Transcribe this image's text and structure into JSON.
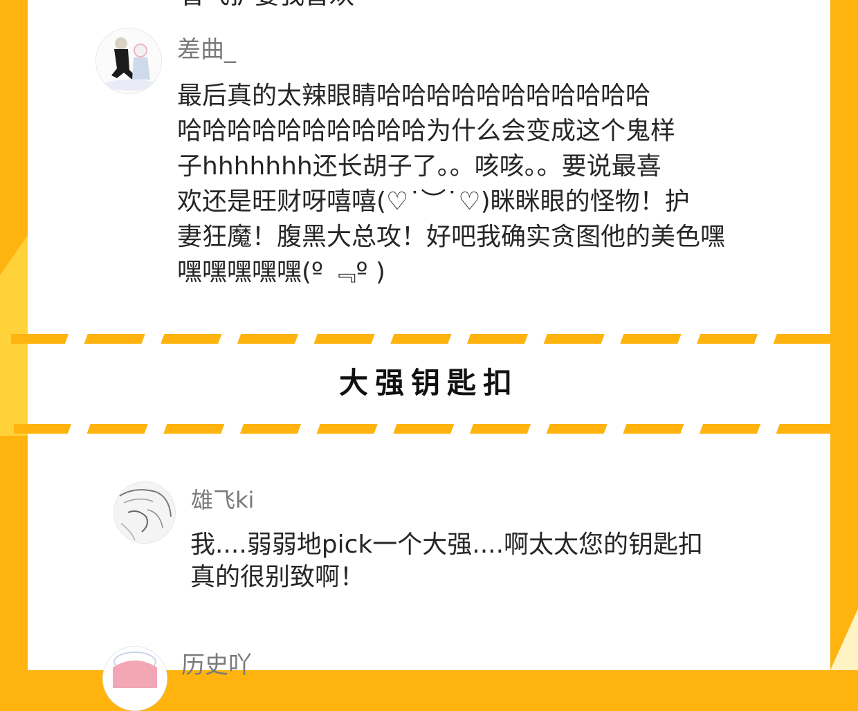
{
  "clipped_top_text": "曾飞护妻我喜欢",
  "comments": [
    {
      "username": "差曲_",
      "lines": [
        "最后真的太辣眼睛哈哈哈哈哈哈哈哈哈哈哈",
        "哈哈哈哈哈哈哈哈哈哈为什么会变成这个鬼样",
        "子hhhhhhh还长胡子了。。咳咳。。要说最喜",
        "欢还是旺财呀嘻嘻(♡˙︶˙♡)眯眯眼的怪物！护",
        "妻狂魔！腹黑大总攻！好吧我确实贪图他的美色嘿",
        "嘿嘿嘿嘿嘿(º ﹃º )"
      ]
    },
    {
      "username": "雄飞ki",
      "lines": [
        "我....弱弱地pick一个大强....啊太太您的钥匙扣",
        "真的很别致啊！"
      ]
    },
    {
      "username": "历史吖",
      "lines": []
    }
  ],
  "section_title": "大强钥匙扣",
  "colors": {
    "accent": "#ffb30f",
    "panel": "#ffffff",
    "username": "#7a7a7a",
    "text": "#262626"
  }
}
